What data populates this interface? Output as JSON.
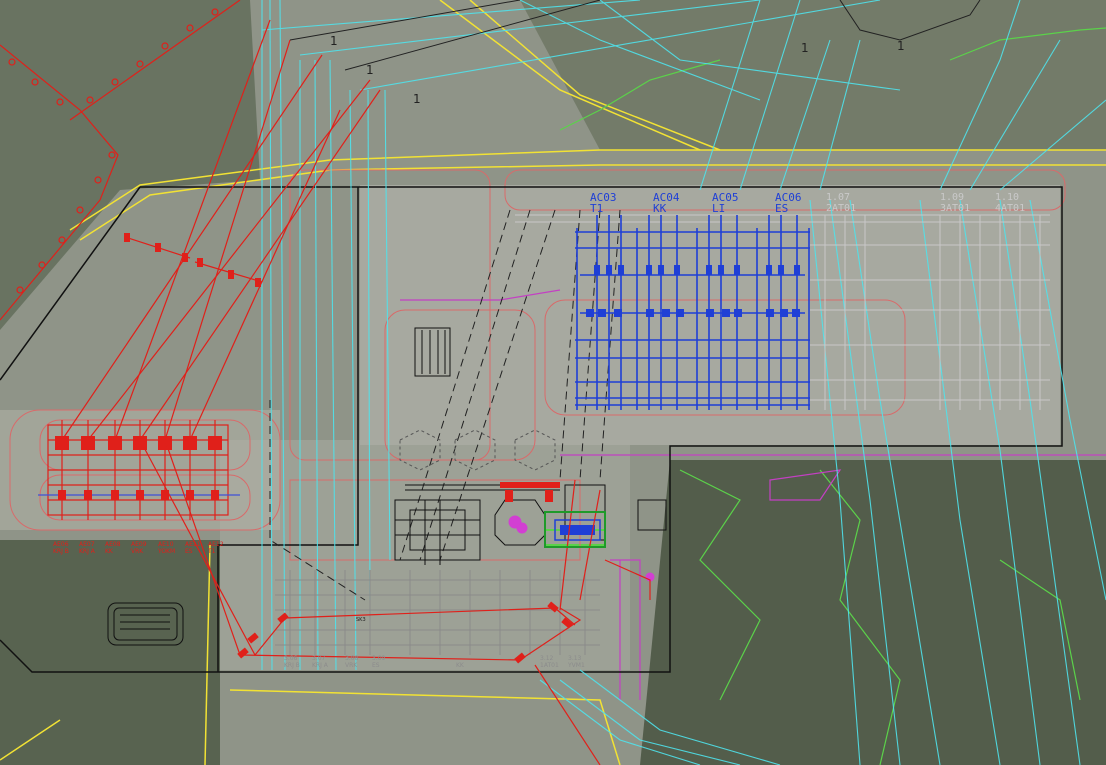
{
  "map": {
    "colors": {
      "terrain": "#8f9488",
      "forest": "#4f5a47",
      "paved_yard": "#b7b8b0",
      "new_bays": "#1f3fd6",
      "removed": "#e0201a",
      "cable_route": "#4fe3ec",
      "boundary": "#111111",
      "road_edge": "#f2e234",
      "grid_lines": "#c8c8c8",
      "green_contour": "#5bd24a"
    },
    "bay_labels_blue": [
      {
        "code": "AC03",
        "name": "T1"
      },
      {
        "code": "AC04",
        "name": "KK"
      },
      {
        "code": "AC05",
        "name": "LI"
      },
      {
        "code": "AC06",
        "name": "ES"
      }
    ],
    "bay_labels_grey": [
      {
        "code": "1.07",
        "name": "2AT01"
      },
      {
        "code": "1.09",
        "name": "3AT01"
      },
      {
        "code": "1.10",
        "name": "4AT01"
      }
    ],
    "bay_labels_red": [
      {
        "code": "AE06",
        "name": "KRJ B"
      },
      {
        "code": "AE07",
        "name": "KRJ A"
      },
      {
        "code": "AE08",
        "name": "KK"
      },
      {
        "code": "AE09",
        "name": "VRK"
      },
      {
        "code": "AE10",
        "name": "YOKM"
      },
      {
        "code": "AE11",
        "name": "ES"
      },
      {
        "code": "AE12",
        "name": "T1"
      }
    ],
    "bay_labels_bottom": [
      {
        "code": "3.06",
        "name": "KRJ B"
      },
      {
        "code": "3.07",
        "name": "KRJ A"
      },
      {
        "code": "3.08",
        "name": "VRK"
      },
      {
        "code": "3.09",
        "name": "ES"
      },
      {
        "code": "",
        "name": "KK"
      },
      {
        "code": "3.12",
        "name": "1AT01"
      },
      {
        "code": "3.13",
        "name": "YVM1"
      }
    ],
    "contour_marks": [
      "1",
      "1",
      "1",
      "1",
      "1"
    ],
    "small_tag": "SK3"
  }
}
